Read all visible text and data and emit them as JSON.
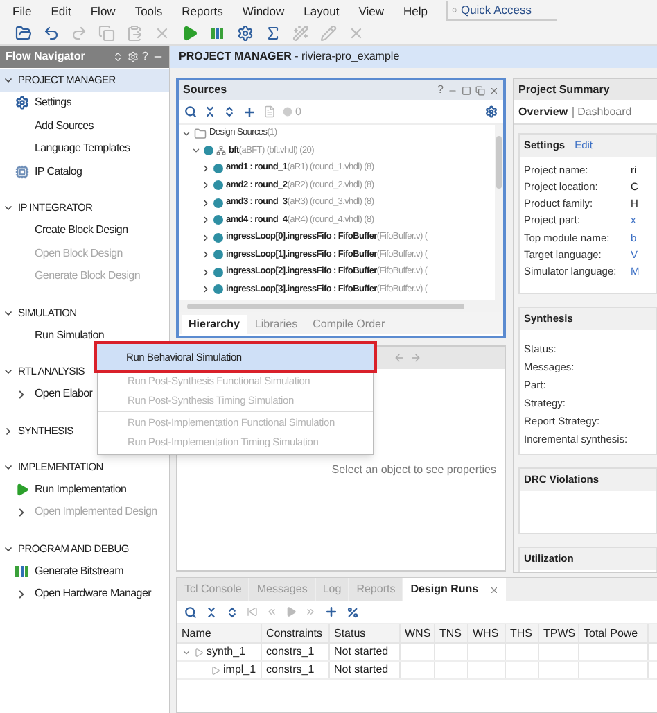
{
  "menu_bar": [
    "File",
    "Edit",
    "Flow",
    "Tools",
    "Reports",
    "Window",
    "Layout",
    "View",
    "Help"
  ],
  "quick_access": {
    "placeholder": "Quick Access"
  },
  "toolbar": [
    {
      "kind": "open",
      "disabled": false
    },
    {
      "kind": "undo",
      "disabled": false
    },
    {
      "kind": "redo",
      "disabled": true
    },
    {
      "kind": "copy",
      "disabled": true
    },
    {
      "kind": "paste",
      "disabled": true
    },
    {
      "kind": "delete",
      "disabled": true
    },
    {
      "kind": "run",
      "disabled": false
    },
    {
      "kind": "bitstream",
      "disabled": false
    },
    {
      "kind": "settings",
      "disabled": false
    },
    {
      "kind": "sigma",
      "disabled": false
    },
    {
      "kind": "wand",
      "disabled": true
    },
    {
      "kind": "pen",
      "disabled": true
    },
    {
      "kind": "cross",
      "disabled": true
    }
  ],
  "flow_navigator": {
    "title": "Flow Navigator",
    "help": "?",
    "sections": [
      {
        "label": "PROJECT MANAGER",
        "expanded": true,
        "selected": true,
        "items": [
          {
            "label": "Settings",
            "kind": "gear",
            "disabled": false
          },
          {
            "label": "Add Sources",
            "kind": "plain",
            "disabled": false
          },
          {
            "label": "Language Templates",
            "kind": "plain",
            "disabled": false
          },
          {
            "label": "IP Catalog",
            "kind": "chip",
            "disabled": false
          }
        ]
      },
      {
        "label": "IP INTEGRATOR",
        "expanded": true,
        "selected": false,
        "items": [
          {
            "label": "Create Block Design",
            "kind": "plain",
            "disabled": false
          },
          {
            "label": "Open Block Design",
            "kind": "plain",
            "disabled": true
          },
          {
            "label": "Generate Block Design",
            "kind": "plain",
            "disabled": true
          }
        ]
      },
      {
        "label": "SIMULATION",
        "expanded": true,
        "selected": false,
        "items": [
          {
            "label": "Run Simulation",
            "kind": "plain",
            "disabled": false
          }
        ]
      },
      {
        "label": "RTL ANALYSIS",
        "expanded": true,
        "selected": false,
        "items": [
          {
            "label": "Open Elabor",
            "kind": "expander",
            "disabled": false
          }
        ]
      },
      {
        "label": "SYNTHESIS",
        "expanded": false,
        "selected": false
      },
      {
        "label": "IMPLEMENTATION",
        "expanded": true,
        "selected": false,
        "items": [
          {
            "label": "Run Implementation",
            "kind": "run",
            "disabled": false
          },
          {
            "label": "Open Implemented Design",
            "kind": "expander",
            "disabled": true
          }
        ]
      },
      {
        "label": "PROGRAM AND DEBUG",
        "expanded": true,
        "selected": false,
        "items": [
          {
            "label": "Generate Bitstream",
            "kind": "bitstream",
            "disabled": false
          },
          {
            "label": "Open Hardware Manager",
            "kind": "expander",
            "disabled": false
          }
        ]
      }
    ]
  },
  "main_header": "**PROJECT MANAGER** - riviera-pro_example",
  "sources": {
    "title": "Sources",
    "help": "?",
    "count": "0",
    "tree": [
      {
        "label": "Design Sources",
        "detail": "(1)",
        "kind": "folder",
        "expanded": true,
        "children": [
          {
            "label": "bft",
            "detail": "(aBFT) (bft.vhdl) (20)",
            "kind": "top",
            "expanded": true,
            "children": [
              {
                "label": "amd1 : round_1",
                "detail": "(aR1) (round_1.vhdl) (8)",
                "kind": "module",
                "expanded": false
              },
              {
                "label": "amd2 : round_2",
                "detail": "(aR2) (round_2.vhdl) (8)",
                "kind": "module",
                "expanded": false
              },
              {
                "label": "amd3 : round_3",
                "detail": "(aR3) (round_3.vhdl) (8)",
                "kind": "module",
                "expanded": false
              },
              {
                "label": "amd4 : round_4",
                "detail": "(aR4) (round_4.vhdl) (8)",
                "kind": "module",
                "expanded": false
              },
              {
                "label": "ingressLoop[0].ingressFifo : FifoBuffer",
                "detail": "(FifoBuffer.v) (",
                "kind": "module",
                "expanded": false
              },
              {
                "label": "ingressLoop[1].ingressFifo : FifoBuffer",
                "detail": "(FifoBuffer.v) (",
                "kind": "module",
                "expanded": false
              },
              {
                "label": "ingressLoop[2].ingressFifo : FifoBuffer",
                "detail": "(FifoBuffer.v) (",
                "kind": "module",
                "expanded": false
              },
              {
                "label": "ingressLoop[3].ingressFifo : FifoBuffer",
                "detail": "(FifoBuffer.v) (",
                "kind": "module",
                "expanded": false
              }
            ]
          }
        ]
      }
    ],
    "tabs": [
      {
        "label": "Hierarchy",
        "selected": true
      },
      {
        "label": "Libraries",
        "selected": false
      },
      {
        "label": "Compile Order",
        "selected": false
      }
    ]
  },
  "context_menu": {
    "groups": [
      [
        {
          "label": "Run Behavioral Simulation",
          "selected": true,
          "disabled": false
        },
        {
          "label": "Run Post-Synthesis Functional Simulation",
          "selected": false,
          "disabled": true
        },
        {
          "label": "Run Post-Synthesis Timing Simulation",
          "selected": false,
          "disabled": true
        }
      ],
      [
        {
          "label": "Run Post-Implementation Functional Simulation",
          "selected": false,
          "disabled": true
        },
        {
          "label": "Run Post-Implementation Timing Simulation",
          "selected": false,
          "disabled": true
        }
      ]
    ]
  },
  "properties": {
    "message": "Select an object to see properties"
  },
  "project_summary": {
    "title": "Project Summary",
    "tabs": [
      {
        "label": "Overview",
        "selected": true
      },
      {
        "label": "Dashboard",
        "selected": false
      }
    ],
    "sections": [
      {
        "title": "Settings",
        "action": "Edit",
        "rows": [
          {
            "label": "Project name:",
            "value": "ri",
            "link": false
          },
          {
            "label": "Project location:",
            "value": "C",
            "link": false
          },
          {
            "label": "Product family:",
            "value": "H",
            "link": false
          },
          {
            "label": "Project part:",
            "value": "x",
            "link": true
          },
          {
            "label": "Top module name:",
            "value": "b",
            "link": true
          },
          {
            "label": "Target language:",
            "value": "V",
            "link": true
          },
          {
            "label": "Simulator language:",
            "value": "M",
            "link": true
          }
        ]
      },
      {
        "title": "Synthesis",
        "rows": [
          {
            "label": "Status:"
          },
          {
            "label": "Messages:"
          },
          {
            "label": "Part:"
          },
          {
            "label": "Strategy:"
          },
          {
            "label": "Report Strategy:"
          },
          {
            "label": "Incremental synthesis:"
          }
        ]
      },
      {
        "title": "DRC Violations"
      },
      {
        "title": "Utilization"
      }
    ]
  },
  "bottom_panel": {
    "tabs": [
      {
        "label": "Tcl Console",
        "selected": false,
        "closable": false
      },
      {
        "label": "Messages",
        "selected": false,
        "closable": false
      },
      {
        "label": "Log",
        "selected": false,
        "closable": false
      },
      {
        "label": "Reports",
        "selected": false,
        "closable": false
      },
      {
        "label": "Design Runs",
        "selected": true,
        "closable": true
      }
    ],
    "columns": [
      "Name",
      "Constraints",
      "Status",
      "WNS",
      "TNS",
      "WHS",
      "THS",
      "TPWS",
      "Total Powe"
    ],
    "rows": [
      {
        "name": "synth_1",
        "constraints": "constrs_1",
        "status": "Not started",
        "expanded": true,
        "children": [
          {
            "name": "impl_1",
            "constraints": "constrs_1",
            "status": "Not started"
          }
        ]
      }
    ]
  }
}
